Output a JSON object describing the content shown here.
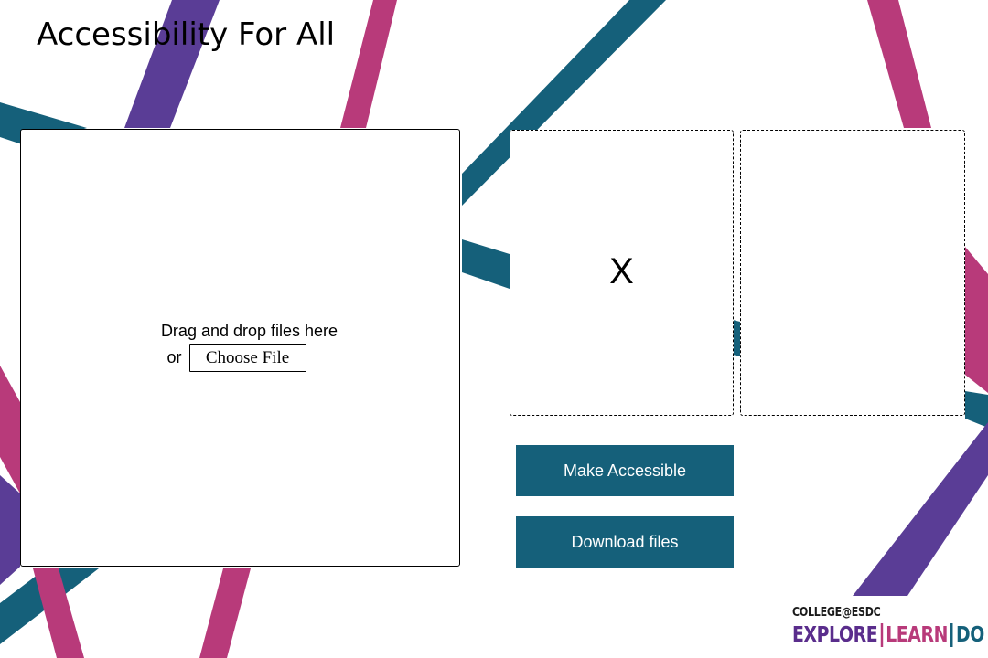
{
  "page": {
    "title": "Accessibility For All"
  },
  "dropzone": {
    "text": "Drag and drop files here",
    "or_text": "or",
    "choose_label": "Choose File"
  },
  "preview": {
    "left_text": "X",
    "right_text": ""
  },
  "actions": {
    "make_accessible_label": "Make Accessible",
    "download_label": "Download files"
  },
  "logo": {
    "top": "COLLEGE@ESDC",
    "explore": "EXPLORE",
    "learn": "LEARN",
    "do": "DO"
  },
  "colors": {
    "teal": "#15607a",
    "purple": "#5a3d96",
    "magenta": "#b83a7a"
  }
}
